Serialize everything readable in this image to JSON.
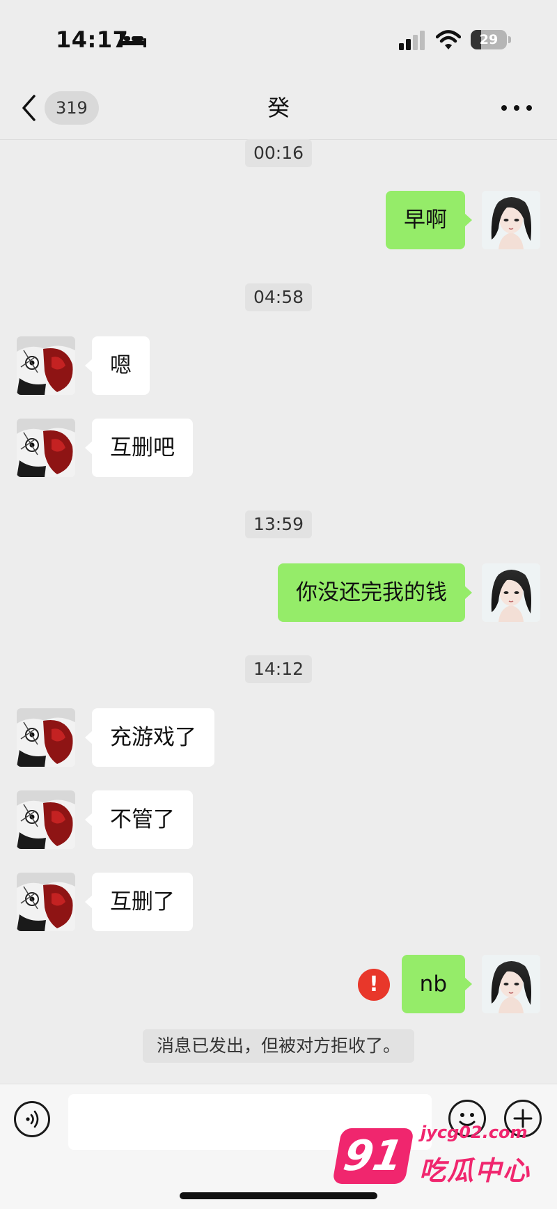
{
  "status_bar": {
    "time": "14:17",
    "battery_level": "29",
    "battery_fraction": 0.29,
    "icons": [
      "bed-icon",
      "signal-icon",
      "wifi-icon",
      "battery-icon"
    ]
  },
  "nav": {
    "back_icon": "chevron-left-icon",
    "unread_count": "319",
    "title": "癸",
    "more_icon": "more-dots-icon"
  },
  "messages": [
    {
      "type": "time",
      "text": "00:16"
    },
    {
      "type": "out",
      "text": "早啊"
    },
    {
      "type": "time",
      "text": "04:58"
    },
    {
      "type": "in",
      "text": "嗯"
    },
    {
      "type": "in",
      "text": "互删吧"
    },
    {
      "type": "time",
      "text": "13:59"
    },
    {
      "type": "out",
      "text": "你没还完我的钱"
    },
    {
      "type": "time",
      "text": "14:12"
    },
    {
      "type": "in",
      "text": "充游戏了"
    },
    {
      "type": "in",
      "text": "不管了"
    },
    {
      "type": "in",
      "text": "互删了"
    },
    {
      "type": "out",
      "text": "nb",
      "failed": true,
      "fail_glyph": "!"
    },
    {
      "type": "system",
      "text": "消息已发出，但被对方拒收了。"
    }
  ],
  "input_bar": {
    "voice_icon": "voice-icon",
    "message_value": "",
    "emoji_icon": "emoji-icon",
    "plus_icon": "plus-icon"
  },
  "watermark": {
    "number": "91",
    "url": "jycg02.com",
    "name": "吃瓜中心"
  },
  "colors": {
    "background": "#ededed",
    "outgoing_bubble": "#95ec69",
    "incoming_bubble": "#ffffff",
    "error_red": "#e8372a",
    "watermark_pink": "#f0266e"
  }
}
